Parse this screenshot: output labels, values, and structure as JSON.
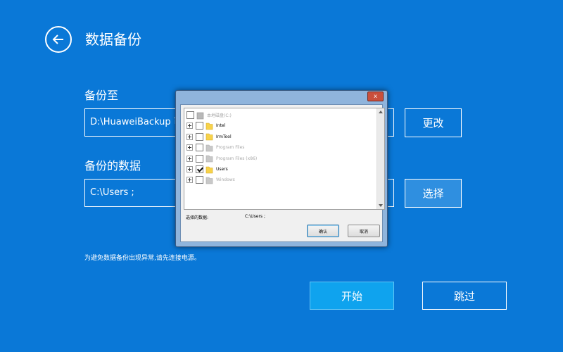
{
  "header": {
    "back_icon": "back-arrow-icon",
    "title": "数据备份"
  },
  "backup_to": {
    "label": "备份至",
    "path": "D:\\HuaweiBackup  可用",
    "change_button": "更改"
  },
  "backup_data": {
    "label": "备份的数据",
    "value": "C:\\Users ;",
    "select_button": "选择"
  },
  "notice": "为避免数据备份出现异常,请先连接电源。",
  "actions": {
    "start": "开始",
    "skip": "跳过"
  },
  "dialog": {
    "close_label": "x",
    "tree": [
      {
        "label": "本地磁盘(C:)",
        "checked": false,
        "disabled": true,
        "icon": "drive-icon",
        "expander": false
      },
      {
        "label": "Intel",
        "checked": false,
        "disabled": false,
        "icon": "folder-icon",
        "expander": true
      },
      {
        "label": "IrmTool",
        "checked": false,
        "disabled": false,
        "icon": "folder-icon",
        "expander": true
      },
      {
        "label": "Program Files",
        "checked": false,
        "disabled": true,
        "icon": "folder-icon",
        "expander": true
      },
      {
        "label": "Program Files (x86)",
        "checked": false,
        "disabled": true,
        "icon": "folder-icon",
        "expander": true
      },
      {
        "label": "Users",
        "checked": true,
        "disabled": false,
        "icon": "folder-icon",
        "expander": true
      },
      {
        "label": "Windows",
        "checked": false,
        "disabled": true,
        "icon": "folder-icon",
        "expander": true
      }
    ],
    "selected_label": "选择的数据:",
    "selected_value": "C:\\Users ;",
    "ok_button": "确认",
    "cancel_button": "取消"
  },
  "colors": {
    "background": "#0a78d7",
    "primary_button": "#0fa3ee",
    "folder": "#f7d24a",
    "folder_disabled": "#c8c8c8"
  }
}
